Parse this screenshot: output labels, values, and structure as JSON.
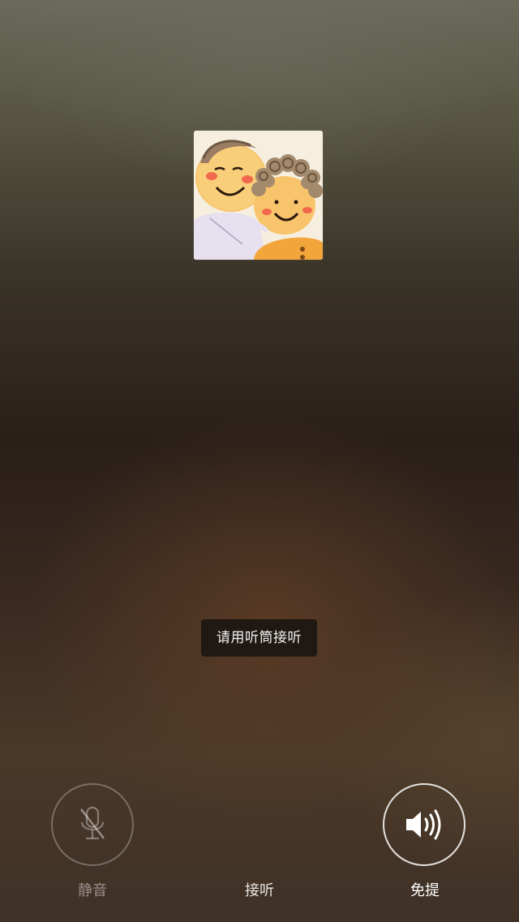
{
  "call": {
    "toast": "请用听筒接听",
    "mute_label": "静音",
    "answer_label": "接听",
    "speaker_label": "免提"
  },
  "icons": {
    "avatar": "illustrated-couple-avatar",
    "mute": "microphone-muted-icon",
    "speaker": "speaker-icon"
  }
}
